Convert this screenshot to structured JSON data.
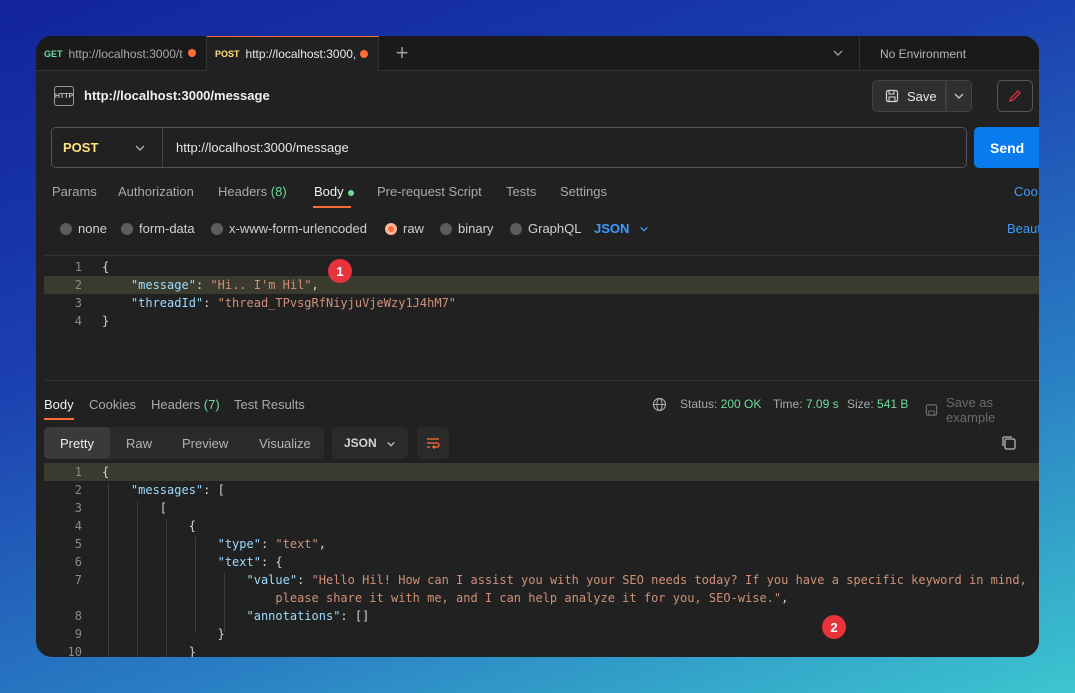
{
  "tabs": [
    {
      "method": "GET",
      "title": "http://localhost:3000/t"
    },
    {
      "method": "POST",
      "title": "http://localhost:3000,"
    }
  ],
  "add_tab": "+",
  "environment": "No Environment",
  "request": {
    "icon_text": "HTTP",
    "title": "http://localhost:3000/message",
    "save_label": "Save",
    "method": "POST",
    "url": "http://localhost:3000/message",
    "send_label": "Send"
  },
  "request_tabs": {
    "params": "Params",
    "authorization": "Authorization",
    "headers": "Headers",
    "headers_count": "(8)",
    "body": "Body",
    "pre_request": "Pre-request Script",
    "tests": "Tests",
    "settings": "Settings",
    "cookies": "Coo"
  },
  "body_modes": {
    "none": "none",
    "form_data": "form-data",
    "urlencoded": "x-www-form-urlencoded",
    "raw": "raw",
    "binary": "binary",
    "graphql": "GraphQL",
    "language": "JSON",
    "beautify": "Beaut"
  },
  "request_body": {
    "lines": [
      {
        "n": "1",
        "open": "{"
      },
      {
        "n": "2",
        "key": "\"message\"",
        "sep": ": ",
        "val": "\"Hi.. I'm Hil\"",
        "end": ","
      },
      {
        "n": "3",
        "key": "\"threadId\"",
        "sep": ": ",
        "val": "\"thread_TPvsgRfNiyjuVjeWzy1J4hM7\"",
        "end": ""
      },
      {
        "n": "4",
        "open": "}"
      }
    ]
  },
  "badges": {
    "one": "1",
    "two": "2"
  },
  "response_tabs": {
    "body": "Body",
    "cookies": "Cookies",
    "headers": "Headers",
    "headers_count": "(7)",
    "test_results": "Test Results"
  },
  "status": {
    "status_label": "Status:",
    "status_value": "200 OK",
    "time_label": "Time:",
    "time_value": "7.09 s",
    "size_label": "Size:",
    "size_value": "541 B",
    "save_example": "Save as example"
  },
  "view_modes": {
    "pretty": "Pretty",
    "raw": "Raw",
    "preview": "Preview",
    "visualize": "Visualize",
    "format": "JSON"
  },
  "response_body": {
    "lines": [
      {
        "n": "1",
        "text": "{"
      },
      {
        "n": "2",
        "key": "\"messages\"",
        "rest": ": ["
      },
      {
        "n": "3",
        "text": "["
      },
      {
        "n": "4",
        "text": "{"
      },
      {
        "n": "5",
        "key": "\"type\"",
        "sep": ": ",
        "val": "\"text\"",
        "end": ","
      },
      {
        "n": "6",
        "key": "\"text\"",
        "rest": ": {"
      },
      {
        "n": "7",
        "key": "\"value\"",
        "sep": ": ",
        "val": "\"Hello Hil! How can I assist you with your SEO needs today? If you have a specific keyword in mind,"
      },
      {
        "n": "",
        "val": "please share it with me, and I can help analyze it for you, SEO-wise.\"",
        "end": ","
      },
      {
        "n": "8",
        "key": "\"annotations\"",
        "rest": ": []"
      },
      {
        "n": "9",
        "text": "}"
      },
      {
        "n": "10",
        "text": "}"
      }
    ]
  },
  "colors": {
    "accent": "#ff6c37",
    "send": "#097bed",
    "post": "#ffe47e",
    "get": "#6bdd9a",
    "badge": "#e8323c"
  }
}
